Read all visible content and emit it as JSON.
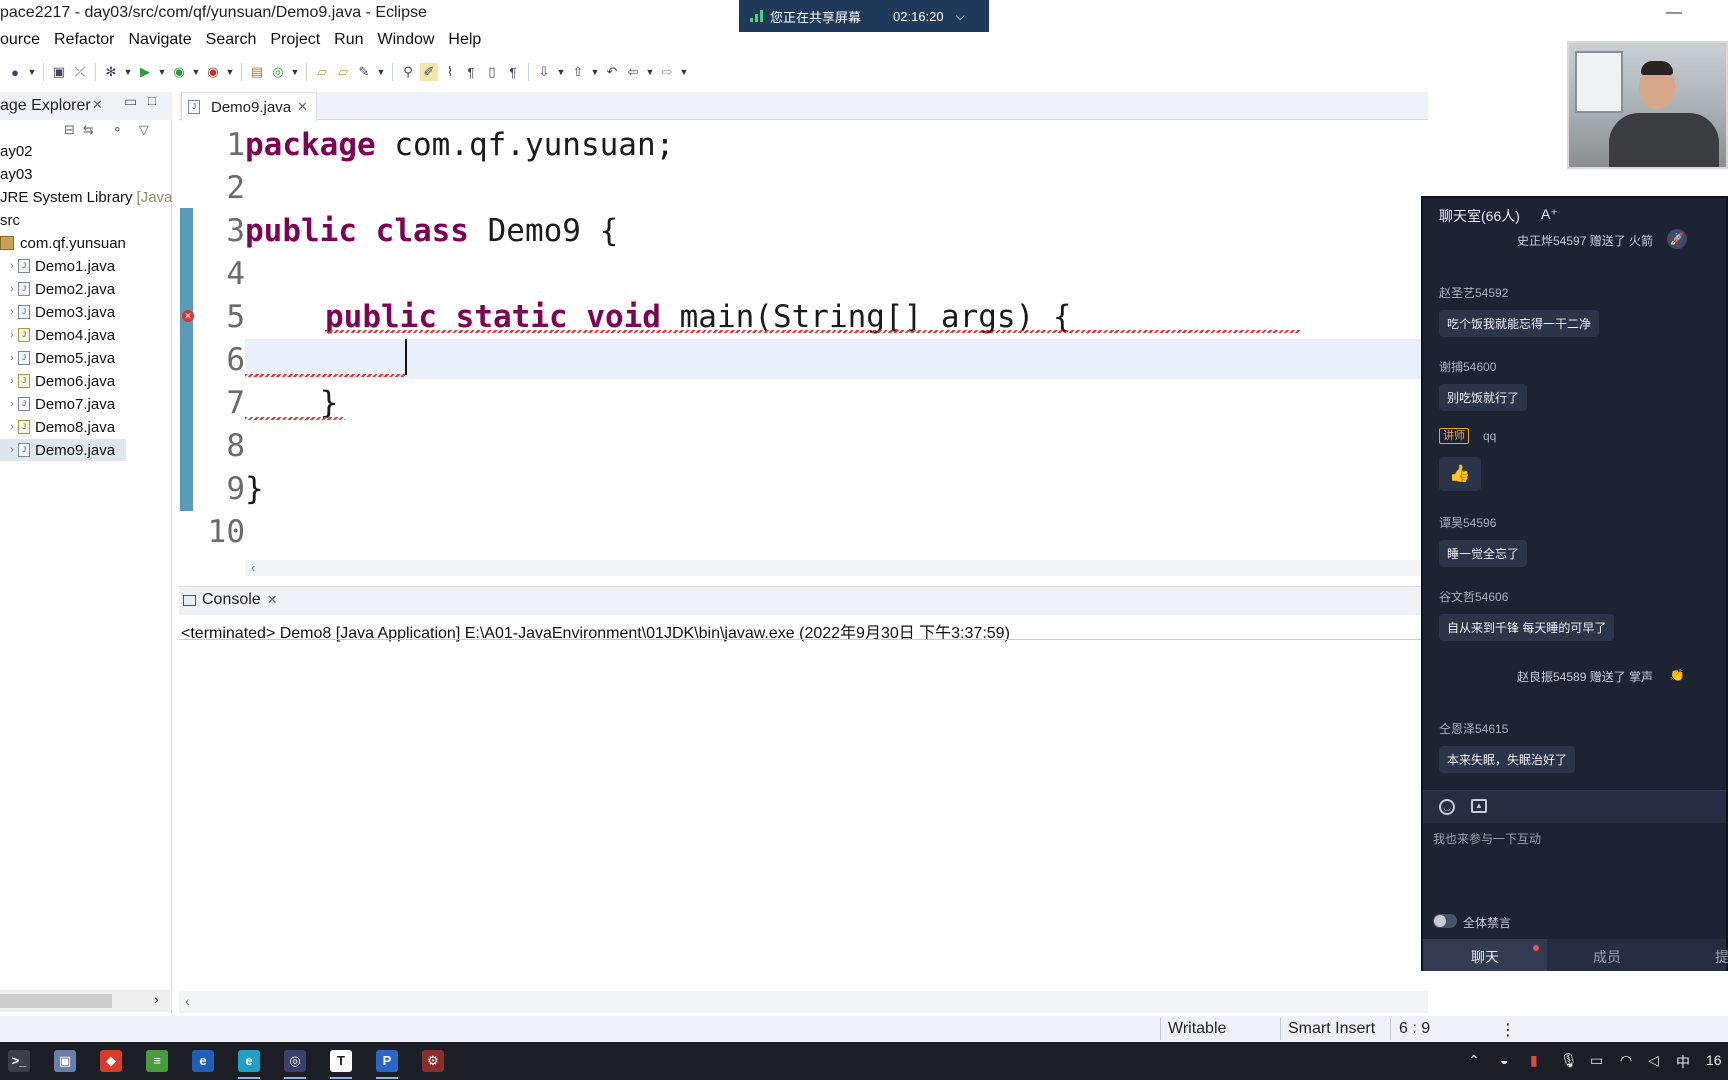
{
  "window": {
    "title": "pace2217 - day03/src/com/qf/yunsuan/Demo9.java - Eclipse",
    "minimize": "—"
  },
  "share": {
    "text": "您正在共享屏幕",
    "time": "02:16:20",
    "chevron": "⌵"
  },
  "menu": [
    "ource",
    "Refactor",
    "Navigate",
    "Search",
    "Project",
    "Run",
    "Window",
    "Help"
  ],
  "toolbar": {
    "icons": [
      "run-config-icon",
      "new-window-icon",
      "skip-breakpoints-icon",
      "debug-icon",
      "run-icon",
      "coverage-icon",
      "external-tools-icon",
      "new-java-project-icon",
      "new-class-icon",
      "open-type-icon",
      "open-resource-icon",
      "search-icon",
      "toggle-mark-occurrences-icon",
      "toggle-highlight-icon",
      "block-selection-icon",
      "show-whitespace-icon",
      "next-annotation-icon",
      "previous-annotation-icon",
      "last-edit-icon",
      "back-icon",
      "forward-icon"
    ]
  },
  "package_explorer": {
    "title": "age Explorer",
    "close": "✕",
    "tree": [
      {
        "label": "ay02",
        "indent": 0,
        "type": "project"
      },
      {
        "label": "ay03",
        "indent": 0,
        "type": "project"
      },
      {
        "label": "JRE System Library",
        "suffix": "[Java",
        "indent": 0,
        "type": "library"
      },
      {
        "label": "src",
        "indent": 0,
        "type": "folder"
      },
      {
        "label": "com.qf.yunsuan",
        "indent": 1,
        "type": "package"
      },
      {
        "label": "Demo1.java",
        "indent": 2,
        "type": "java"
      },
      {
        "label": "Demo2.java",
        "indent": 2,
        "type": "java"
      },
      {
        "label": "Demo3.java",
        "indent": 2,
        "type": "java"
      },
      {
        "label": "Demo4.java",
        "indent": 2,
        "type": "java-warn"
      },
      {
        "label": "Demo5.java",
        "indent": 2,
        "type": "java"
      },
      {
        "label": "Demo6.java",
        "indent": 2,
        "type": "java-warn"
      },
      {
        "label": "Demo7.java",
        "indent": 2,
        "type": "java"
      },
      {
        "label": "Demo8.java",
        "indent": 2,
        "type": "java-warn"
      },
      {
        "label": "Demo9.java",
        "indent": 2,
        "type": "java",
        "selected": true
      }
    ]
  },
  "editor": {
    "tab_label": "Demo9.java",
    "tab_close": "✕",
    "line_numbers": [
      "1",
      "2",
      "3",
      "4",
      "5",
      "6",
      "7",
      "8",
      "9",
      "10"
    ],
    "lines": {
      "l1_kw": "package",
      "l1_rest": " com.qf.yunsuan;",
      "l3_kw1": "public",
      "l3_kw2": "class",
      "l3_rest": " Demo9 {",
      "l5_kw1": "public",
      "l5_kw2": "static",
      "l5_kw3": "void",
      "l5_rest": " main(String[] args) {",
      "l7": "    }",
      "l9": "}"
    },
    "error_marker": "✕",
    "cursor": {
      "line": 6,
      "column": 9
    }
  },
  "console": {
    "tab_label": "Console",
    "close": "✕",
    "output": "<terminated> Demo8 [Java Application] E:\\A01-JavaEnvironment\\01JDK\\bin\\javaw.exe (2022年9月30日 下午3:37:59)"
  },
  "statusbar": {
    "writable": "Writable",
    "insert_mode": "Smart Insert",
    "position": "6 : 9",
    "dots": "⋮"
  },
  "taskbar": {
    "apps": [
      {
        "name": "terminal-app-icon",
        "color": "#3b3f47",
        "glyph": ">_"
      },
      {
        "name": "paint-app-icon",
        "color": "#6a7ea8",
        "glyph": "▣"
      },
      {
        "name": "media-app-icon",
        "color": "#d83a2e",
        "glyph": "◆"
      },
      {
        "name": "notepad-app-icon",
        "color": "#4a9b3f",
        "glyph": "≡"
      },
      {
        "name": "ie-app-icon",
        "color": "#1e5fb8",
        "glyph": "e"
      },
      {
        "name": "edge-app-icon",
        "color": "#1fa0c4",
        "glyph": "e"
      },
      {
        "name": "eclipse-app-icon",
        "color": "#3a3f6b",
        "glyph": "◎"
      },
      {
        "name": "typora-app-icon",
        "color": "#ffffff",
        "glyph": "T",
        "text": "#1b1e24"
      },
      {
        "name": "pdf-app-icon",
        "color": "#2a66c8",
        "glyph": "P"
      },
      {
        "name": "git-app-icon",
        "color": "#8b2d2d",
        "glyph": "⚙"
      }
    ],
    "tray": {
      "up": "⌃",
      "ime": "中",
      "clock": "16"
    }
  },
  "chat": {
    "title": "聊天室(66人)",
    "font_btn": "A⁺",
    "gift1": {
      "text": "史正烨54597 赠送了 火箭",
      "icon": "🚀"
    },
    "messages": [
      {
        "user": "赵圣艺54592",
        "text": "吃个饭我就能忘得一干二净"
      },
      {
        "user": "谢捕54600",
        "text": "别吃饭就行了"
      },
      {
        "user": "谭昊54596",
        "text": "睡一觉全忘了"
      },
      {
        "user": "谷文哲54606",
        "text": "自从来到千锋 每天睡的可早了"
      },
      {
        "user": "仝恩泽54615",
        "text": "本来失眠，失眠治好了"
      }
    ],
    "teacher": {
      "badge": "讲师",
      "name": "qq",
      "reaction": "👍"
    },
    "gift2": {
      "text": "赵良振54589 赠送了 掌声",
      "icon": "👏"
    },
    "input_placeholder": "我也来参与一下互动",
    "mute_label": "全体禁言",
    "tabs": {
      "chat": "聊天",
      "members": "成员",
      "third": "提"
    }
  }
}
